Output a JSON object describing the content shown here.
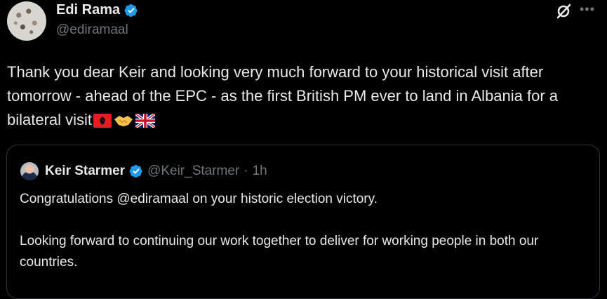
{
  "author": {
    "display_name": "Edi Rama",
    "handle": "@ediramaal"
  },
  "tweet": {
    "text": "Thank you dear Keir and looking very much forward to your historical visit after tomorrow - ahead of the EPC - as the first British PM ever to land in Albania for a bilateral visit"
  },
  "emojis": [
    "albania-flag",
    "handshake",
    "uk-flag"
  ],
  "quoted": {
    "display_name": "Keir Starmer",
    "handle": "@Keir_Starmer",
    "separator": "·",
    "time": "1h",
    "paragraph1": "Congratulations @ediramaal on your historic election victory.",
    "paragraph2": "Looking forward to continuing our work together to deliver for working people in both our countries."
  },
  "colors": {
    "background": "#000000",
    "text": "#e7e9ea",
    "secondary": "#71767b",
    "verified": "#1d9bf0",
    "border": "#2f3336"
  }
}
